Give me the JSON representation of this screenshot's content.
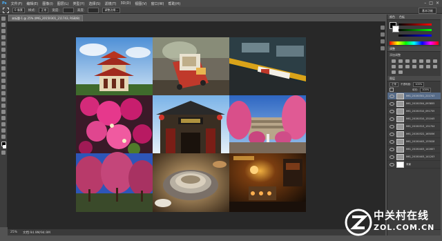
{
  "menubar": {
    "items": [
      "Ps",
      "文件(F)",
      "编辑(E)",
      "图像(I)",
      "图层(L)",
      "类型(Y)",
      "选择(S)",
      "滤镜(T)",
      "3D(D)",
      "视图(V)",
      "窗口(W)",
      "帮助(H)"
    ]
  },
  "options": {
    "size_value": "0 像素",
    "style_label": "样式:",
    "style_value": "正常",
    "width_label": "宽度:",
    "height_label": "高度:",
    "refine_label": "调整边缘...",
    "workspace": "基本功能"
  },
  "document": {
    "tab_title": "未标题-1 @ 25% (IMG_20150301_211743, RGB/8)"
  },
  "status": {
    "zoom": "25%",
    "doc_info": "文档:94.9M/94.9M"
  },
  "panels": {
    "color_tab": "颜色",
    "swatches_tab": "色板",
    "adjust_tab": "调整",
    "adjust_title": "添加调整",
    "layers_tab": "图层",
    "blend_mode": "正常",
    "opacity_label": "不透明度:",
    "opacity_value": "100%",
    "fill_label": "填充:",
    "fill_value": "100%"
  },
  "layers": [
    "IMG_20150301_211743",
    "IMG_20150304_093855",
    "IMG_20150310_091759",
    "IMG_20150310_131045",
    "IMG_20150313_131704",
    "IMG_20150322_165056",
    "IMG_20150403_133028",
    "IMG_20150403_141607",
    "IMG_20150403_141203",
    "背景"
  ],
  "watermark": {
    "title": "中关村在线",
    "subtitle": "ZOL.COM.CN"
  },
  "colors": {
    "selected_layer": "#566b88",
    "canvas_bg": "#282828",
    "ui_bg": "#535353"
  }
}
